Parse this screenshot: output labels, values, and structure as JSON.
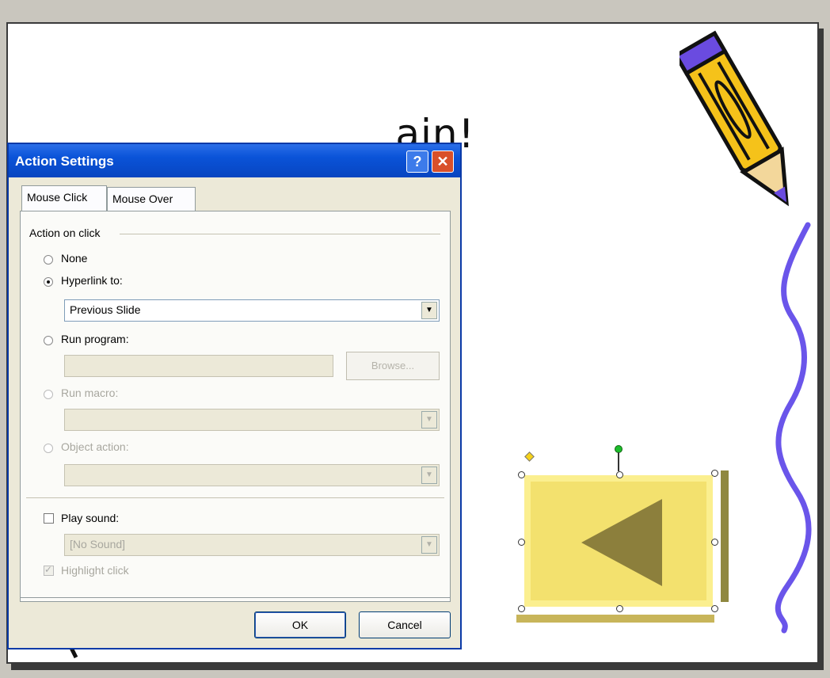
{
  "slide": {
    "title_visible": "ain!"
  },
  "dialog": {
    "title": "Action Settings",
    "help_glyph": "?",
    "close_glyph": "✕",
    "tabs": [
      {
        "label": "Mouse Click",
        "active": true
      },
      {
        "label": "Mouse Over",
        "active": false
      }
    ],
    "group_label": "Action on click",
    "options": {
      "none": "None",
      "hyperlink": "Hyperlink to:",
      "run_program": "Run program:",
      "run_macro": "Run macro:",
      "object_action": "Object action:"
    },
    "selected_option": "hyperlink",
    "hyperlink_value": "Previous Slide",
    "browse_label": "Browse...",
    "play_sound_label": "Play sound:",
    "sound_value": "[No Sound]",
    "highlight_click_label": "Highlight click",
    "ok_label": "OK",
    "cancel_label": "Cancel",
    "dropdown_glyph": "▼"
  },
  "colors": {
    "titlebar": "#0a53d8",
    "button_fill": "#f3e16e",
    "arrow": "#8c7f3c",
    "pencil_body": "#f5c21a",
    "pencil_stripe": "#6a4be0",
    "squiggle": "#6a55ea"
  },
  "icons": [
    "help-icon",
    "close-icon",
    "pencil-icon",
    "squiggle-line",
    "back-arrow-icon",
    "dropdown-arrow-icon"
  ]
}
